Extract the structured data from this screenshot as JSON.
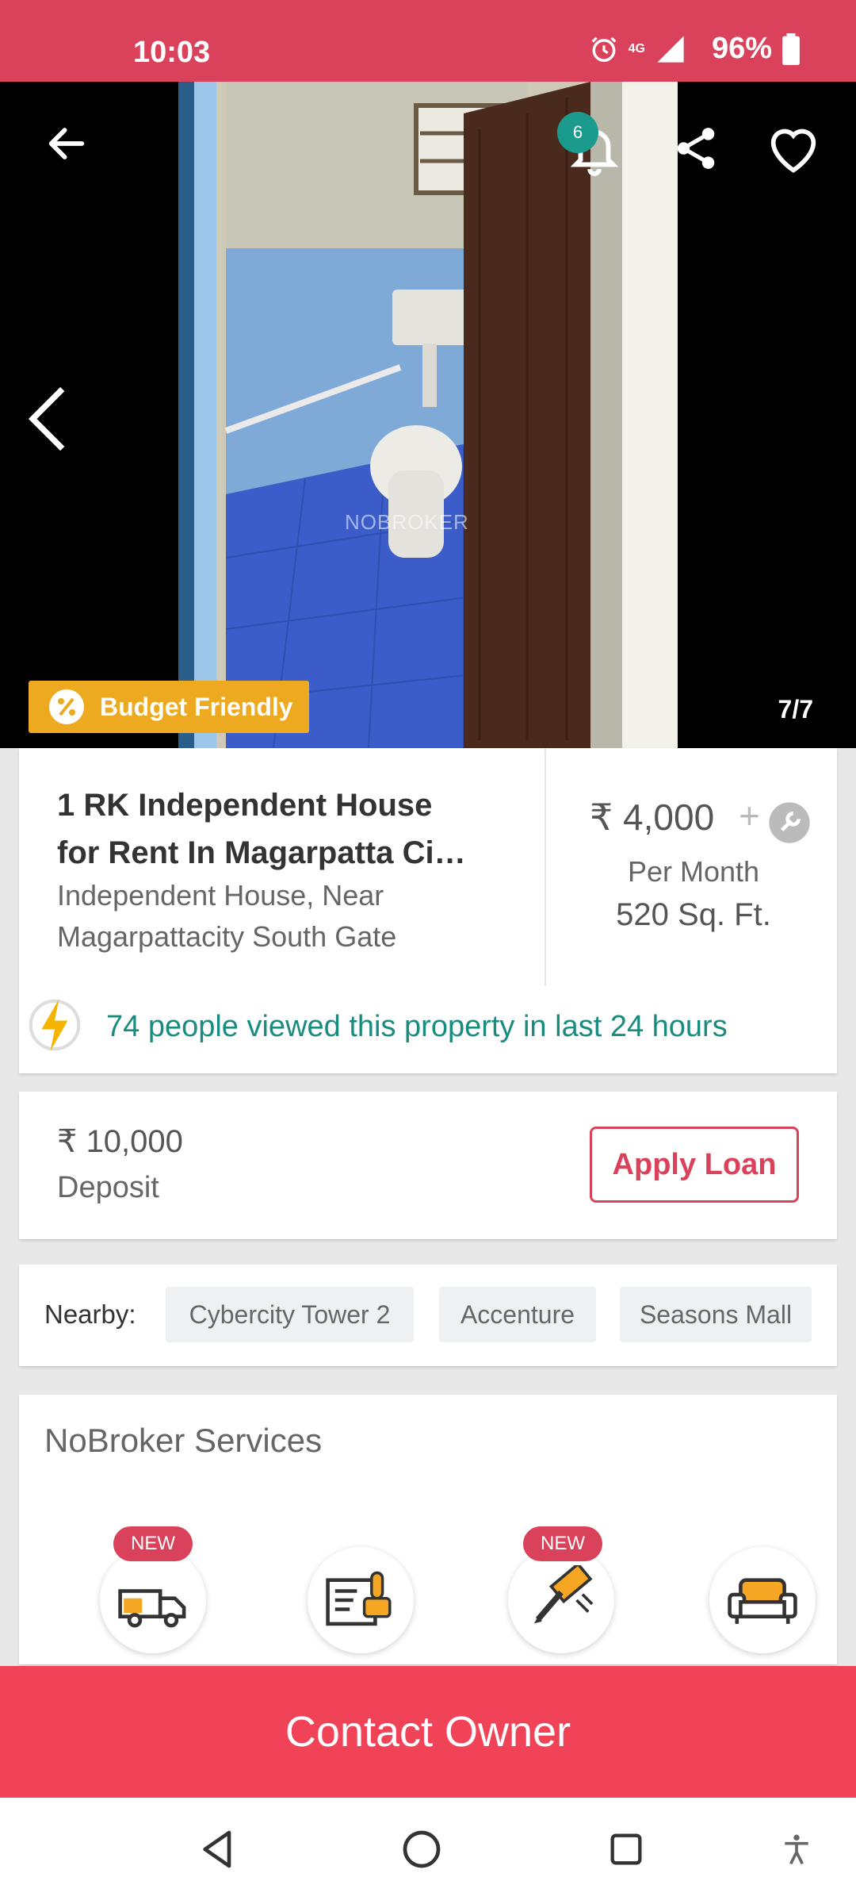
{
  "status_bar": {
    "time": "10:03",
    "network": "4G",
    "battery": "96%"
  },
  "gallery": {
    "watermark": "NOBROKER",
    "notification_count": "6",
    "badge_label": "Budget Friendly",
    "counter": "7/7",
    "icons": [
      "back-arrow-icon",
      "bell-icon",
      "share-icon",
      "heart-icon",
      "chevron-left-icon"
    ]
  },
  "property": {
    "title_line1": "1 RK Independent House",
    "title_line2": "for Rent In Magarpatta Ci…",
    "subtitle": "Independent House, Near Magarpattacity South Gate",
    "price": "₹ 4,000",
    "price_plus": "+",
    "price_unit": "Per Month",
    "area": "520 Sq. Ft.",
    "views_text": "74 people viewed this property in last 24 hours"
  },
  "deposit": {
    "amount": "₹ 10,000",
    "label": "Deposit",
    "apply_button": "Apply Loan"
  },
  "nearby": {
    "label": "Nearby:",
    "places": [
      "Cybercity Tower 2",
      "Accenture",
      "Seasons Mall"
    ]
  },
  "services": {
    "title": "NoBroker Services",
    "badges": [
      "NEW",
      "NEW"
    ],
    "items": [
      "packers-movers-icon",
      "rental-agreement-icon",
      "painting-icon",
      "furniture-icon"
    ]
  },
  "contact_button": "Contact Owner",
  "colors": {
    "brand": "#f14358",
    "status": "#d9425a",
    "teal": "#1a8b7f",
    "badge": "#eda91f"
  }
}
